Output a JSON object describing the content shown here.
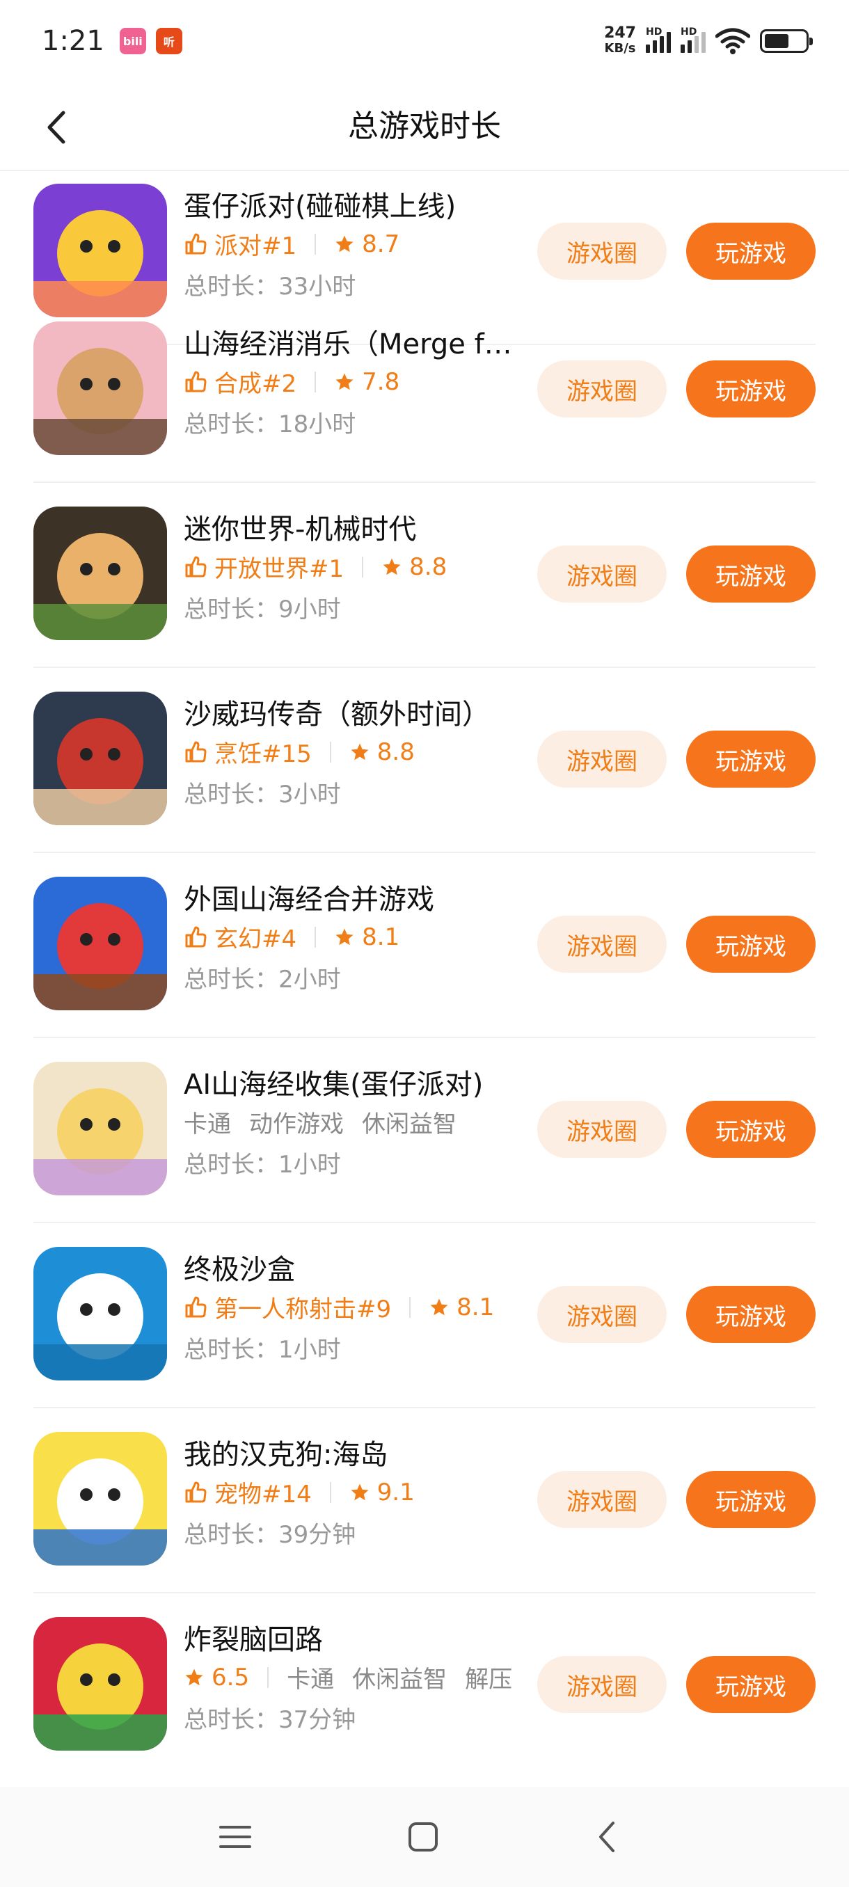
{
  "status": {
    "time": "1:21",
    "notif_icons": [
      "bilibili",
      "听"
    ],
    "net_speed_value": "247",
    "net_speed_unit": "KB/s",
    "hd_label": "HD",
    "battery_level": 0.6
  },
  "header": {
    "title": "总游戏时长"
  },
  "buttons": {
    "circle_label": "游戏圈",
    "play_label": "玩游戏"
  },
  "games": [
    {
      "name": "蛋仔派对(碰碰棋上线)",
      "rank": "派对#1",
      "rating": "8.7",
      "tags": [],
      "duration": "总时长：33小时",
      "icon": "eggy-party-icon",
      "colors": [
        "#7b3fd4",
        "#f9c93b",
        "#ff8a4f"
      ]
    },
    {
      "name": "山海经消消乐（Merge f…",
      "rank": "合成#2",
      "rating": "7.8",
      "tags": [],
      "duration": "总时长：18小时",
      "icon": "merge-pig-icon",
      "colors": [
        "#f3b9c2",
        "#d9a36b",
        "#6b4b3a"
      ]
    },
    {
      "name": "迷你世界-机械时代",
      "rank": "开放世界#1",
      "rating": "8.8",
      "tags": [],
      "duration": "总时长：9小时",
      "icon": "mini-world-icon",
      "colors": [
        "#3d3226",
        "#e9b16a",
        "#5a8f3a"
      ]
    },
    {
      "name": "沙威玛传奇（额外时间）",
      "rank": "烹饪#15",
      "rating": "8.8",
      "tags": [],
      "duration": "总时长：3小时",
      "icon": "shawarma-icon",
      "colors": [
        "#2e3b4e",
        "#c8372d",
        "#e8c9a0"
      ]
    },
    {
      "name": "外国山海经合并游戏",
      "rank": "玄幻#4",
      "rating": "8.1",
      "tags": [],
      "duration": "总时长：2小时",
      "icon": "shark-merge-icon",
      "colors": [
        "#2a6bd8",
        "#e23a3a",
        "#8b4a22"
      ]
    },
    {
      "name": "AI山海经收集(蛋仔派对)",
      "rank": "",
      "rating": "",
      "tags": [
        "卡通",
        "动作游戏",
        "休闲益智"
      ],
      "duration": "总时长：1小时",
      "icon": "eggy-ai-icon",
      "colors": [
        "#f1e4c8",
        "#f6d36c",
        "#c79ad8"
      ]
    },
    {
      "name": "终极沙盒",
      "rank": "第一人称射击#9",
      "rating": "8.1",
      "tags": [],
      "duration": "总时长：1小时",
      "icon": "sandbox-icon",
      "colors": [
        "#1e8fd6",
        "#ffffff",
        "#1574b0"
      ]
    },
    {
      "name": "我的汉克狗:海岛",
      "rank": "宠物#14",
      "rating": "9.1",
      "tags": [],
      "duration": "总时长：39分钟",
      "icon": "hank-dog-icon",
      "colors": [
        "#f9e04a",
        "#ffffff",
        "#2f73c9"
      ]
    },
    {
      "name": "炸裂脑回路",
      "rank": "",
      "rating": "6.5",
      "tags": [
        "卡通",
        "休闲益智",
        "解压"
      ],
      "duration": "总时长：37分钟",
      "icon": "brain-circuit-icon",
      "colors": [
        "#d7263d",
        "#f6d23c",
        "#2ca24b"
      ]
    }
  ],
  "nav": {
    "menu_icon": "menu-icon",
    "home_icon": "home-icon",
    "back_icon": "back-icon"
  },
  "colors": {
    "accent": "#f6741b",
    "accent_text": "#f07d16",
    "accent_soft": "#fdeee3"
  }
}
